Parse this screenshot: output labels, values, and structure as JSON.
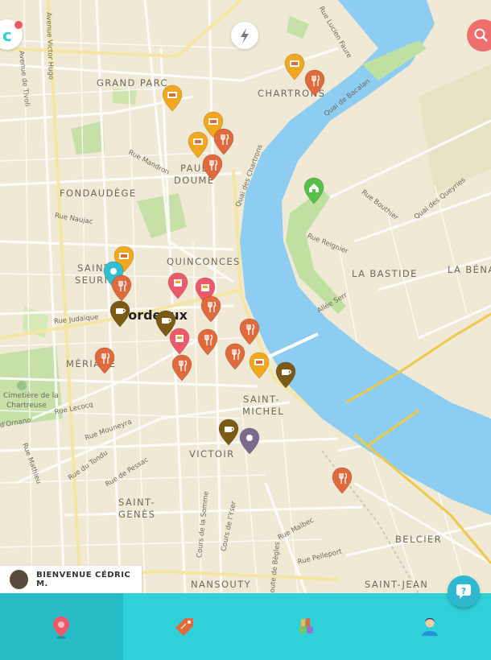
{
  "map": {
    "labels": {
      "grand_parc": "GRAND PARC",
      "chartrons": "CHARTRONS",
      "paulin": "PAUL",
      "doumerc": "DOUME",
      "fondaudege": "FONDAUDÈGE",
      "quinconces": "QUINCONCES",
      "saint": "SAINT-",
      "seurin": "SEURIN",
      "la_bastide": "LA BASTIDE",
      "la_bena": "LA BÉNA",
      "meriadeck": "MÉRIADE",
      "saint_michel_1": "SAINT-",
      "saint_michel_2": "MICHEL",
      "victoire": "VICTOIR",
      "saint_genes_1": "SAINT-",
      "saint_genes_2": "GENÈS",
      "belcier": "BELCIER",
      "nansouty": "NANSOUTY",
      "saint_jean": "SAINT-JEAN"
    },
    "city": "Bordeaux",
    "streets": {
      "victor_hugo": "Avenue Victor Hugo",
      "tivoli": "Avenue de Tivoli",
      "lucien_faure": "Rue Lucien Faure",
      "bacalan": "Quai de Bacalan",
      "mandron": "Rue Mandron",
      "quai_chartrons": "Quai des Chartrons",
      "naujac": "Rue Naujac",
      "bouthier": "Rue Bouthier",
      "queyries": "Quai des Queyries",
      "reignier": "Rue Reignier",
      "serr": "Allée Serr",
      "judaique": "Rue Judaïque",
      "lecocq": "Rue Lecocq",
      "ornano": "d'Ornano",
      "mathieu": "Rue Mathieu",
      "mouneyra": "Rue Mouneyra",
      "tondu": "Rue du Tondu",
      "pessac": "Rue de Pessac",
      "somme": "Cours de la Somme",
      "yser": "Cours de l'Yser",
      "malbec": "Rue Malbec",
      "pelleport": "Rue Pelleport",
      "begles": "Route de Bègles",
      "cimetiere_1": "Cimetière de la",
      "cimetiere_2": "Chartreuse"
    }
  },
  "colors": {
    "restaurant": "#e06a3b",
    "shop": "#f2a81d",
    "cafe": "#7a5a15",
    "pink": "#ef5a6a",
    "purple": "#7b6a8e",
    "green_home": "#58c04a",
    "teal": "#2fbfcf",
    "water": "#8ecdf2",
    "tabbar": "#2fd0d8"
  },
  "pins": [
    {
      "type": "shop-icon",
      "color": "#f2a81d"
    },
    {
      "type": "restaurant-icon",
      "color": "#e06a3b"
    },
    {
      "type": "shop-icon",
      "color": "#f2a81d"
    },
    {
      "type": "shop-icon",
      "color": "#f2a81d"
    },
    {
      "type": "shop-icon",
      "color": "#f2a81d"
    },
    {
      "type": "restaurant-icon",
      "color": "#e06a3b"
    },
    {
      "type": "restaurant-icon",
      "color": "#e06a3b"
    },
    {
      "type": "home-icon",
      "color": "#58c04a"
    },
    {
      "type": "shop-icon",
      "color": "#f2a81d"
    },
    {
      "type": "location-icon",
      "color": "#2fbfcf"
    },
    {
      "type": "restaurant-icon",
      "color": "#e06a3b"
    },
    {
      "type": "cafe-icon",
      "color": "#7a5a15"
    },
    {
      "type": "store-icon",
      "color": "#ef5a6a"
    },
    {
      "type": "store-icon",
      "color": "#ef5a6a"
    },
    {
      "type": "restaurant-icon",
      "color": "#e06a3b"
    },
    {
      "type": "cafe-icon",
      "color": "#7a5a15"
    },
    {
      "type": "store-icon",
      "color": "#ef5a6a"
    },
    {
      "type": "restaurant-icon",
      "color": "#e06a3b"
    },
    {
      "type": "restaurant-icon",
      "color": "#e06a3b"
    },
    {
      "type": "restaurant-icon",
      "color": "#e06a3b"
    },
    {
      "type": "restaurant-icon",
      "color": "#e06a3b"
    },
    {
      "type": "restaurant-icon",
      "color": "#e06a3b"
    },
    {
      "type": "shop-icon",
      "color": "#f2a81d"
    },
    {
      "type": "cafe-icon",
      "color": "#7a5a15"
    },
    {
      "type": "cafe-icon",
      "color": "#7a5a15"
    },
    {
      "type": "location-icon",
      "color": "#7b6a8e"
    },
    {
      "type": "restaurant-icon",
      "color": "#e06a3b"
    }
  ],
  "welcome": {
    "text": "BIENVENUE CÉDRIC M."
  },
  "tabs": [
    {
      "name": "map-pin-icon"
    },
    {
      "name": "price-tag-icon"
    },
    {
      "name": "hands-icon"
    },
    {
      "name": "user-icon"
    }
  ]
}
